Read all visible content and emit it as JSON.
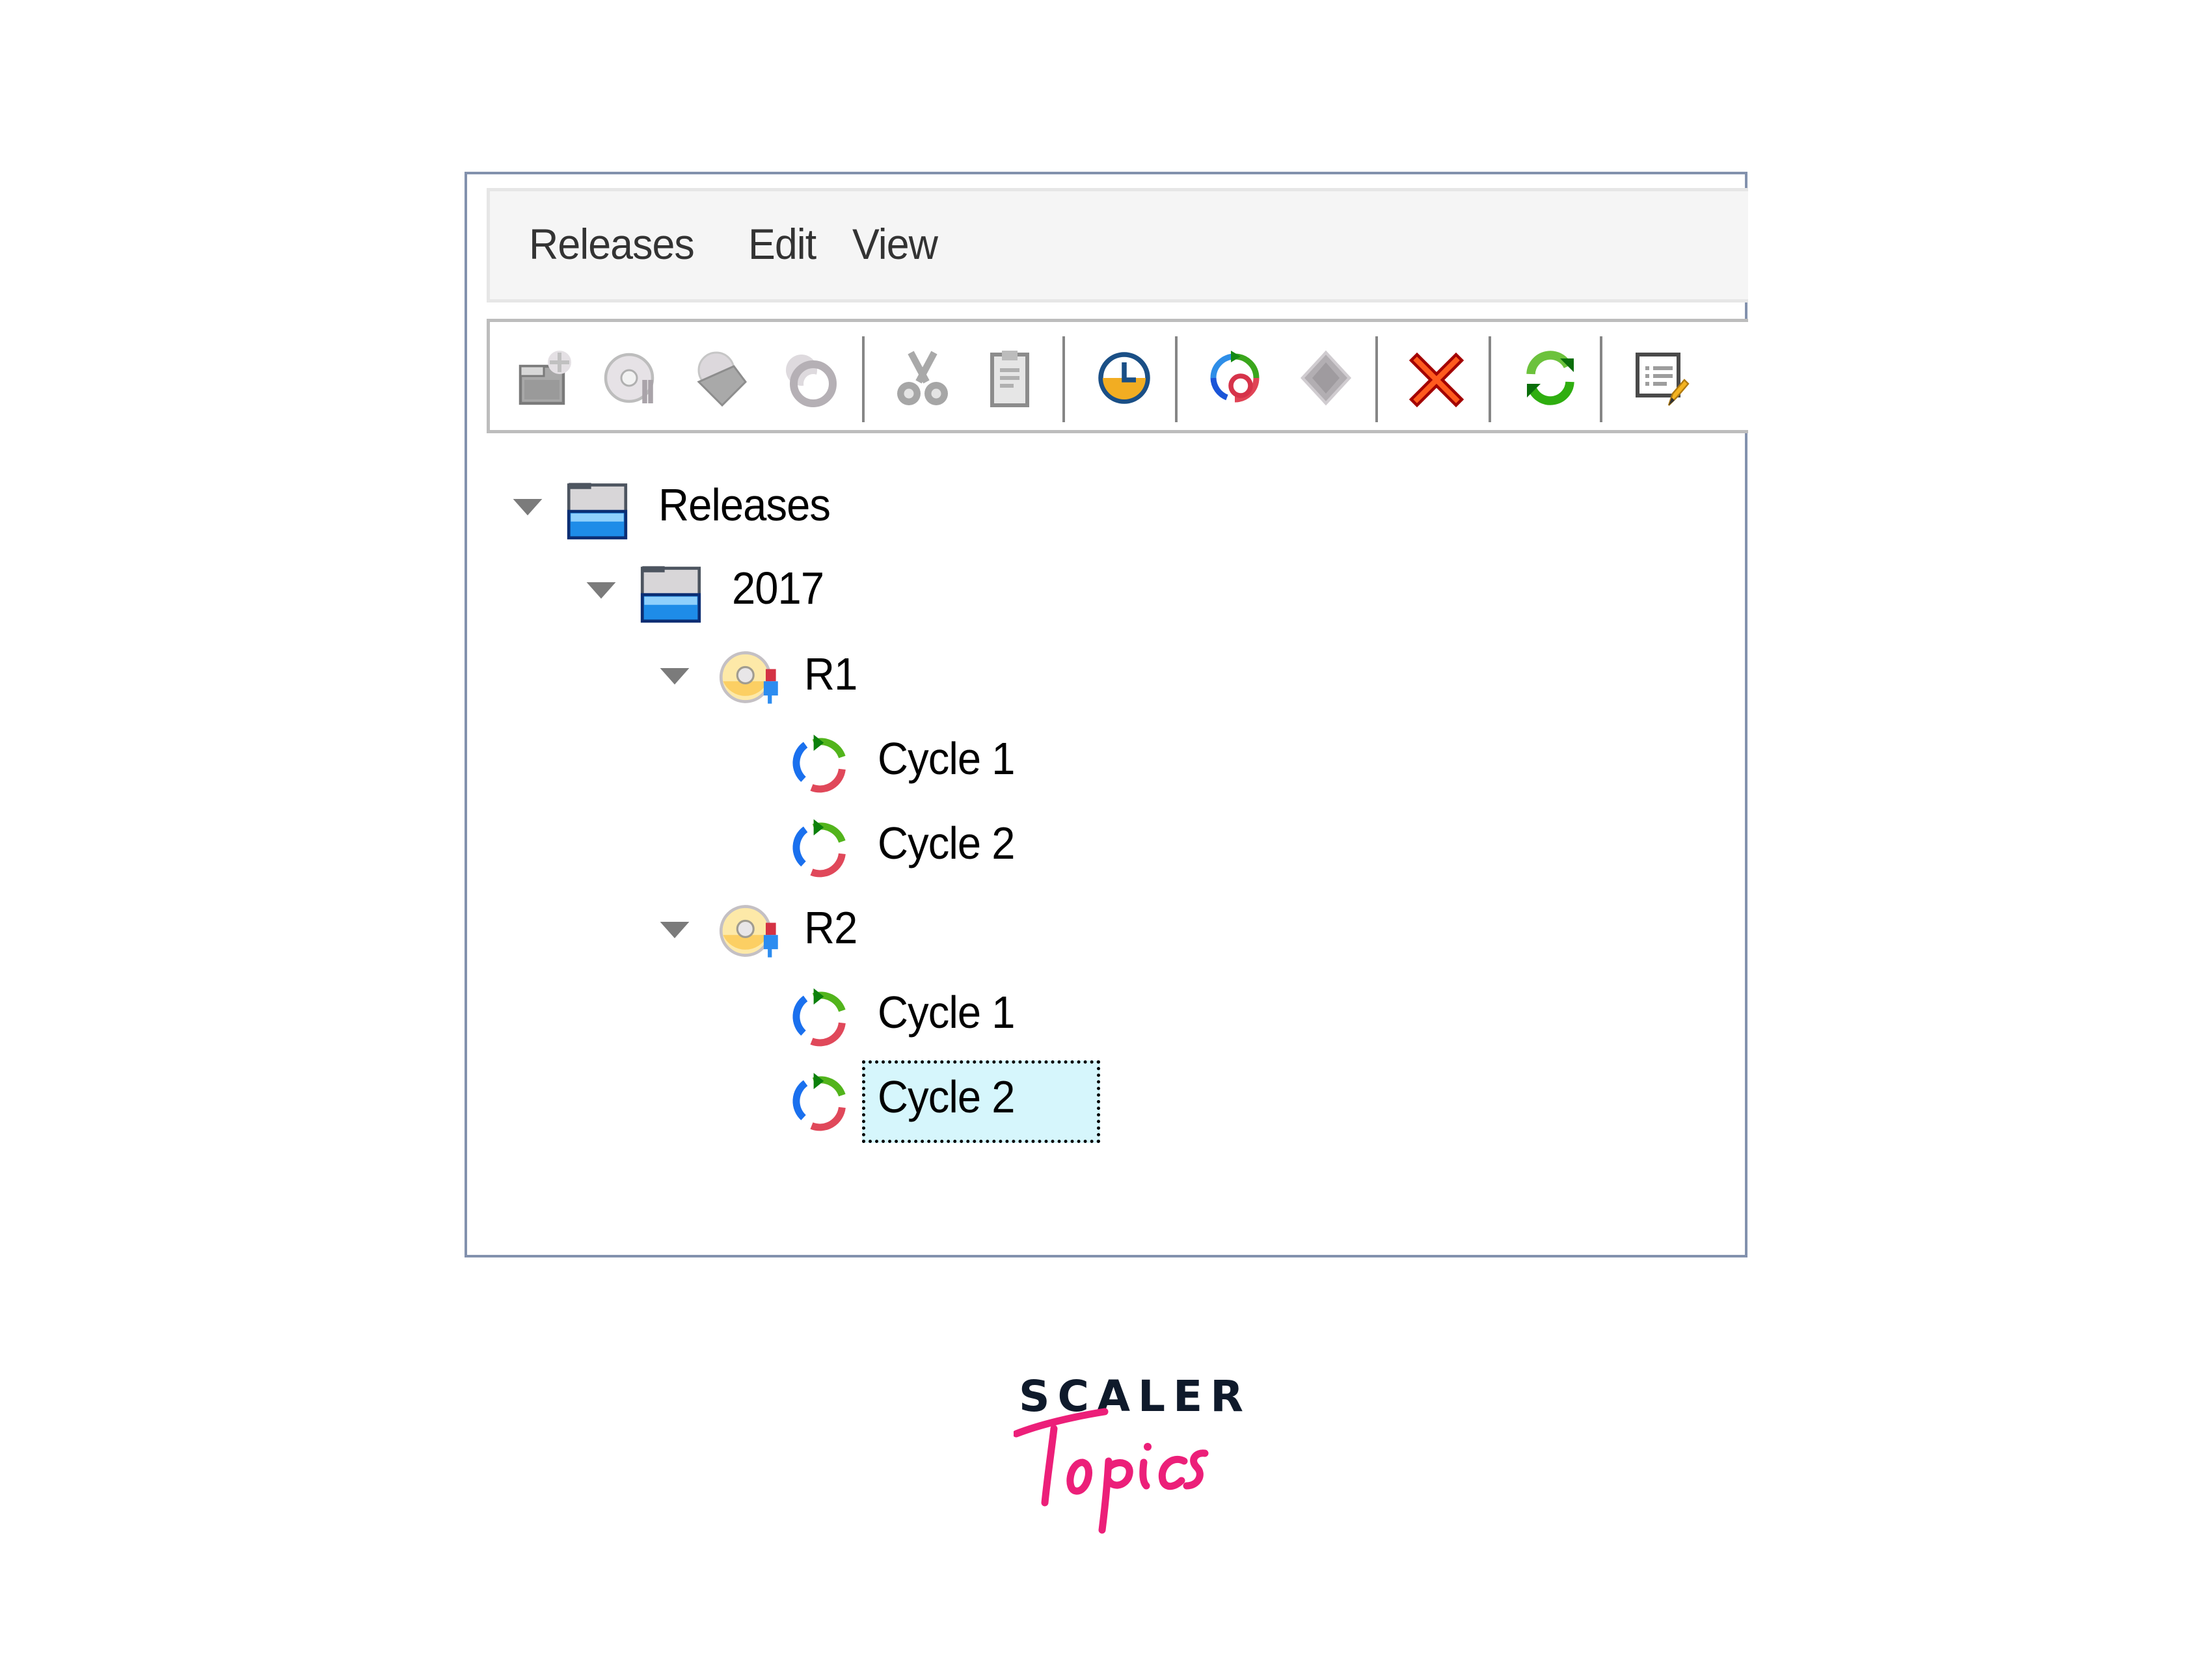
{
  "menubar": {
    "items": [
      {
        "label": "Releases"
      },
      {
        "label": "Edit"
      },
      {
        "label": "View"
      }
    ]
  },
  "toolbar": {
    "buttons": [
      {
        "icon": "new-folder-icon",
        "enabled": false
      },
      {
        "icon": "new-release-icon",
        "enabled": false
      },
      {
        "icon": "new-milestone-icon",
        "enabled": false
      },
      {
        "icon": "new-cycle-icon",
        "enabled": false
      },
      {
        "icon": "cut-icon",
        "enabled": false
      },
      {
        "icon": "paste-icon",
        "enabled": false
      },
      {
        "icon": "clock-icon",
        "enabled": true
      },
      {
        "icon": "assign-cycle-icon",
        "enabled": true
      },
      {
        "icon": "diamond-icon",
        "enabled": false
      },
      {
        "icon": "delete-icon",
        "enabled": true
      },
      {
        "icon": "refresh-icon",
        "enabled": true
      },
      {
        "icon": "details-edit-icon",
        "enabled": true
      }
    ]
  },
  "tree": {
    "nodes": [
      {
        "label": "Releases",
        "type": "folder",
        "level": 0,
        "expanded": true
      },
      {
        "label": "2017",
        "type": "folder",
        "level": 1,
        "expanded": true
      },
      {
        "label": "R1",
        "type": "release",
        "level": 2,
        "expanded": true
      },
      {
        "label": "Cycle 1",
        "type": "cycle",
        "level": 3
      },
      {
        "label": "Cycle 2",
        "type": "cycle",
        "level": 3
      },
      {
        "label": "R2",
        "type": "release",
        "level": 2,
        "expanded": true
      },
      {
        "label": "Cycle 1",
        "type": "cycle",
        "level": 3
      },
      {
        "label": "Cycle 2",
        "type": "cycle",
        "level": 3,
        "selected": true
      }
    ]
  },
  "colors": {
    "frame_border": "#8291ad",
    "selection_fill": "#d6f6fc",
    "menubar_bg": "#f5f5f5",
    "brand_dark": "#0f1a2b",
    "brand_pink": "#ec1f79"
  },
  "logo": {
    "line1": "SCALER",
    "line2": "Topics"
  }
}
